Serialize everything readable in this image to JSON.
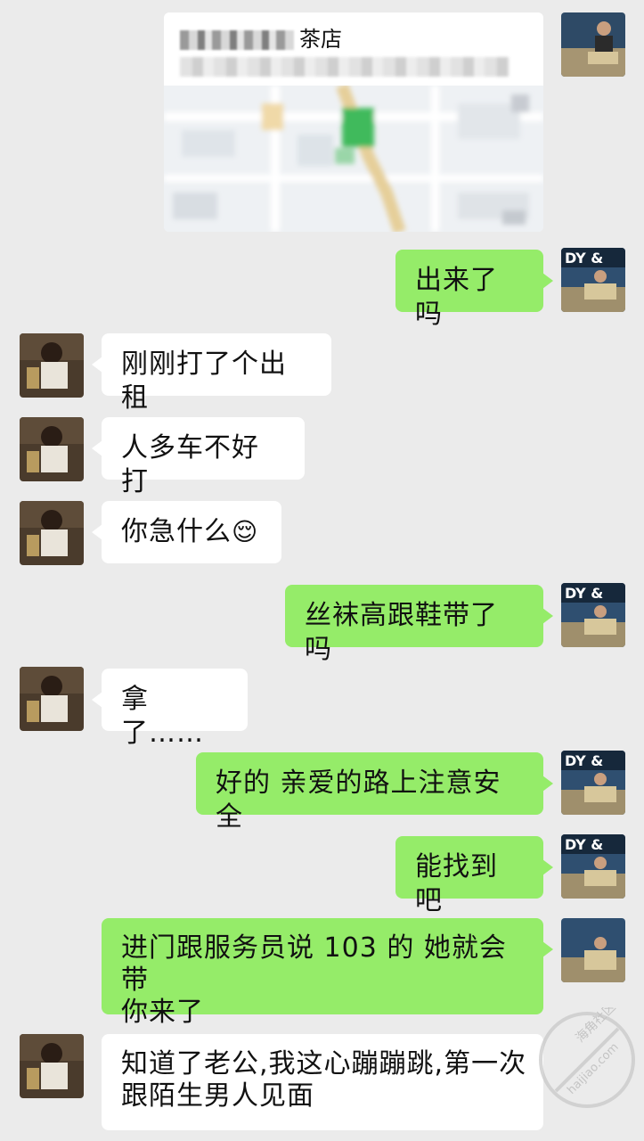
{
  "location": {
    "title": "茶店",
    "map_pin_color": "#28a745"
  },
  "messages": [
    {
      "side": "sent",
      "text": "出来了吗"
    },
    {
      "side": "received",
      "text": "刚刚打了个出租"
    },
    {
      "side": "received",
      "text": "人多车不好打"
    },
    {
      "side": "received",
      "text": "你急什么",
      "emoji": "😌"
    },
    {
      "side": "sent",
      "text": "丝袜高跟鞋带了吗"
    },
    {
      "side": "received",
      "text": "拿了……"
    },
    {
      "side": "sent",
      "text": "好的 亲爱的路上注意安全"
    },
    {
      "side": "sent",
      "text": "能找到吧"
    },
    {
      "side": "sent",
      "line1": "进门跟服务员说 103 的 她就会带",
      "line2": "你来了"
    },
    {
      "side": "received",
      "line1": "知道了老公,我这心蹦蹦跳,第一次",
      "line2": "跟陌生男人见面"
    }
  ],
  "avatar_text": {
    "sent": "DY &"
  },
  "watermark": {
    "brand": "海角社区",
    "url": "haijiao.com"
  },
  "colors": {
    "background": "#ebebeb",
    "sent_bubble": "#95ec69",
    "received_bubble": "#ffffff"
  }
}
